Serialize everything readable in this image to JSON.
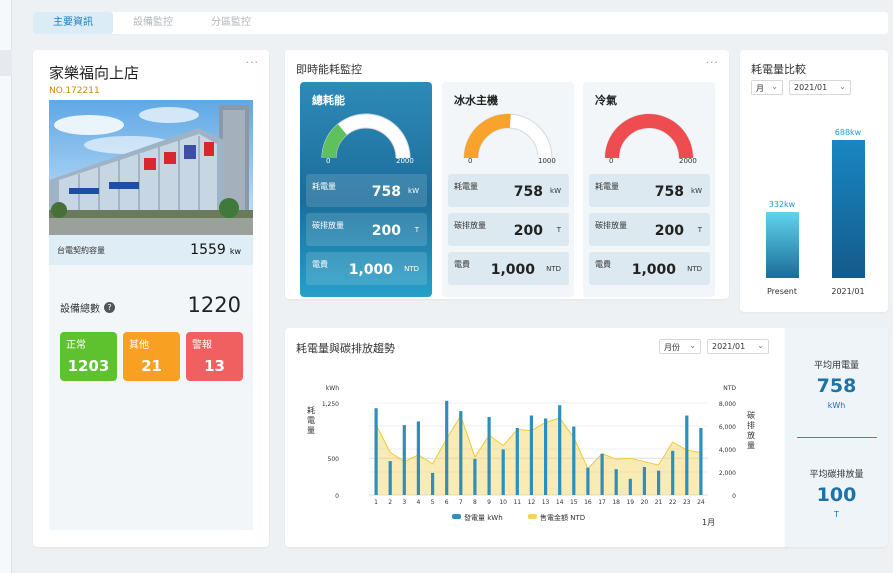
{
  "tabs": [
    {
      "label": "主要資訊",
      "active": true
    },
    {
      "label": "設備監控",
      "active": false
    },
    {
      "label": "分區監控",
      "active": false
    }
  ],
  "store": {
    "name": "家樂福向上店",
    "number": "NO.172211",
    "contract_label": "台電契約容量",
    "contract_value": "1559",
    "contract_unit": "kw",
    "devices_label": "設備總數",
    "devices_total": "1220",
    "status": [
      {
        "label": "正常",
        "value": "1203",
        "color": "#5ec12e"
      },
      {
        "label": "其他",
        "value": "21",
        "color": "#f7a021"
      },
      {
        "label": "警報",
        "value": "13",
        "color": "#f06060"
      }
    ]
  },
  "realtime": {
    "title": "即時能耗監控",
    "panels": [
      {
        "title": "總耗能",
        "min": "0",
        "max": "2000",
        "fill": 0.28,
        "color": "#5ec15b",
        "rows": [
          {
            "label": "耗電量",
            "value": "758",
            "unit": "kW"
          },
          {
            "label": "碳排放量",
            "value": "200",
            "unit": "T"
          },
          {
            "label": "電費",
            "value": "1,000",
            "unit": "NTD"
          }
        ]
      },
      {
        "title": "冰水主機",
        "min": "0",
        "max": "1000",
        "fill": 0.52,
        "color": "#f9a22c",
        "rows": [
          {
            "label": "耗電量",
            "value": "758",
            "unit": "kW"
          },
          {
            "label": "碳排放量",
            "value": "200",
            "unit": "T"
          },
          {
            "label": "電費",
            "value": "1,000",
            "unit": "NTD"
          }
        ]
      },
      {
        "title": "冷氣",
        "min": "0",
        "max": "2000",
        "fill": 1.0,
        "color": "#ee4c4e",
        "rows": [
          {
            "label": "耗電量",
            "value": "758",
            "unit": "kW"
          },
          {
            "label": "碳排放量",
            "value": "200",
            "unit": "T"
          },
          {
            "label": "電費",
            "value": "1,000",
            "unit": "NTD"
          }
        ]
      }
    ]
  },
  "compare": {
    "title": "耗電量比較",
    "period_select": "月",
    "date_select": "2021/01",
    "bars": [
      {
        "label": "Present",
        "value": 332,
        "value_label": "332kw"
      },
      {
        "label": "2021/01",
        "value": 688,
        "value_label": "688kw"
      }
    ]
  },
  "trend": {
    "title": "耗電量與碳排放趨勢",
    "period_select": "月份",
    "date_select": "2021/01",
    "y_left_label": "耗電量",
    "y_right_label": "碳排放量",
    "legend": [
      {
        "label": "發電量 kWh",
        "color": "#2d8fbd"
      },
      {
        "label": "售電金額 NTD",
        "color": "#f3d35b"
      }
    ],
    "month_label": "1月"
  },
  "chart_data": {
    "type": "bar",
    "title": "耗電量與碳排放趨勢",
    "x": [
      1,
      2,
      3,
      4,
      5,
      6,
      7,
      8,
      9,
      10,
      11,
      12,
      13,
      14,
      15,
      16,
      17,
      18,
      19,
      20,
      21,
      22,
      23,
      24
    ],
    "ylabel": "耗電量",
    "y2label": "碳排放量",
    "y_unit": "kWh",
    "y2_unit": "NTD",
    "ylim": [
      0,
      1250
    ],
    "y2lim": [
      0,
      8000
    ],
    "yticks": [
      "0",
      "500",
      "1,250"
    ],
    "y2ticks": [
      "0",
      "2,000",
      "4,000",
      "6,000",
      "8,000"
    ],
    "series": [
      {
        "name": "發電量 kWh",
        "type": "bar",
        "axis": "left",
        "color": "#2d8fbd",
        "values": [
          1180,
          460,
          950,
          1000,
          300,
          1280,
          1140,
          490,
          1060,
          620,
          910,
          1080,
          1040,
          1220,
          930,
          370,
          560,
          350,
          220,
          380,
          330,
          600,
          1080,
          910
        ]
      },
      {
        "name": "售電金額 NTD",
        "type": "area",
        "axis": "right",
        "color": "#f3d35b",
        "values": [
          6100,
          3700,
          2900,
          3500,
          2700,
          4900,
          6900,
          3300,
          5200,
          4300,
          5700,
          5600,
          6300,
          6700,
          5000,
          2300,
          3600,
          3100,
          3200,
          2900,
          2600,
          4600,
          3900,
          3700
        ]
      }
    ],
    "xlabel": "",
    "grid": true,
    "legend_position": "bottom"
  }
}
